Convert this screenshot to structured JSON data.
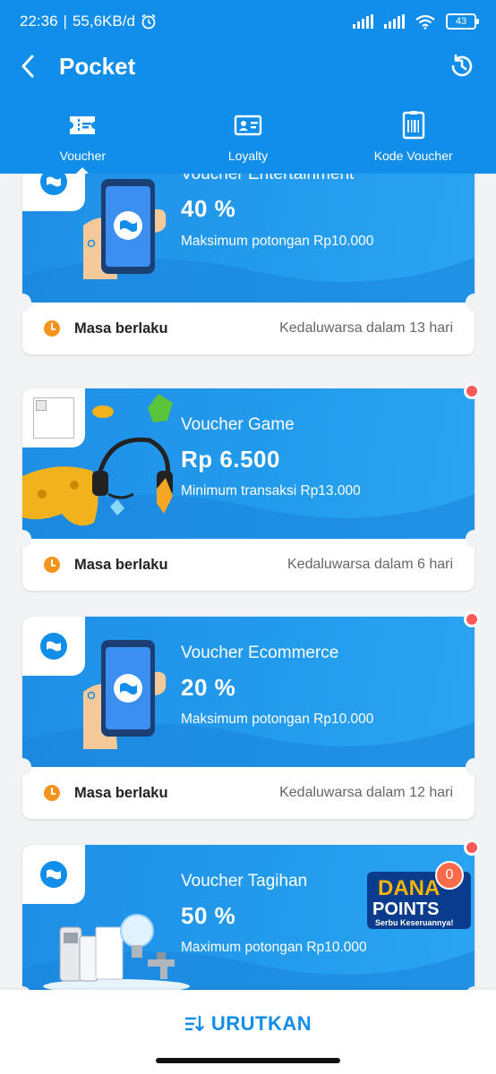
{
  "status": {
    "time": "22:36",
    "speed": "55,6KB/d",
    "battery": "43"
  },
  "header": {
    "title": "Pocket"
  },
  "tabs": [
    {
      "label": "Voucher",
      "icon": "ticket-icon",
      "active": true
    },
    {
      "label": "Loyalty",
      "icon": "member-card-icon",
      "active": false
    },
    {
      "label": "Kode Voucher",
      "icon": "barcode-icon",
      "active": false
    }
  ],
  "vouchers": [
    {
      "title": "Voucher Entertainment",
      "value": "40 %",
      "desc": "Maksimum potongan Rp10.000",
      "masa_label": "Masa berlaku",
      "expiry": "Kedaluwarsa dalam 13 hari",
      "illustration": "phone-hand"
    },
    {
      "title": "Voucher Game",
      "value": "Rp 6.500",
      "desc": "Minimum transaksi Rp13.000",
      "masa_label": "Masa berlaku",
      "expiry": "Kedaluwarsa dalam 6 hari",
      "illustration": "game-gear"
    },
    {
      "title": "Voucher Ecommerce",
      "value": "20 %",
      "desc": "Maksimum potongan Rp10.000",
      "masa_label": "Masa berlaku",
      "expiry": "Kedaluwarsa dalam 12 hari",
      "illustration": "phone-hand"
    },
    {
      "title": "Voucher Tagihan",
      "value": "50 %",
      "desc": "Maximum potongan Rp10.000",
      "illustration": "bills"
    }
  ],
  "dana_points": {
    "line1": "DANA",
    "line2": "POINTS",
    "tagline": "Serbu Keseruannya!",
    "badge": "0"
  },
  "bottom": {
    "sort_label": "URUTKAN"
  },
  "colors": {
    "primary": "#118eea",
    "accent": "#f7941d",
    "dot": "#ff5a5a"
  }
}
